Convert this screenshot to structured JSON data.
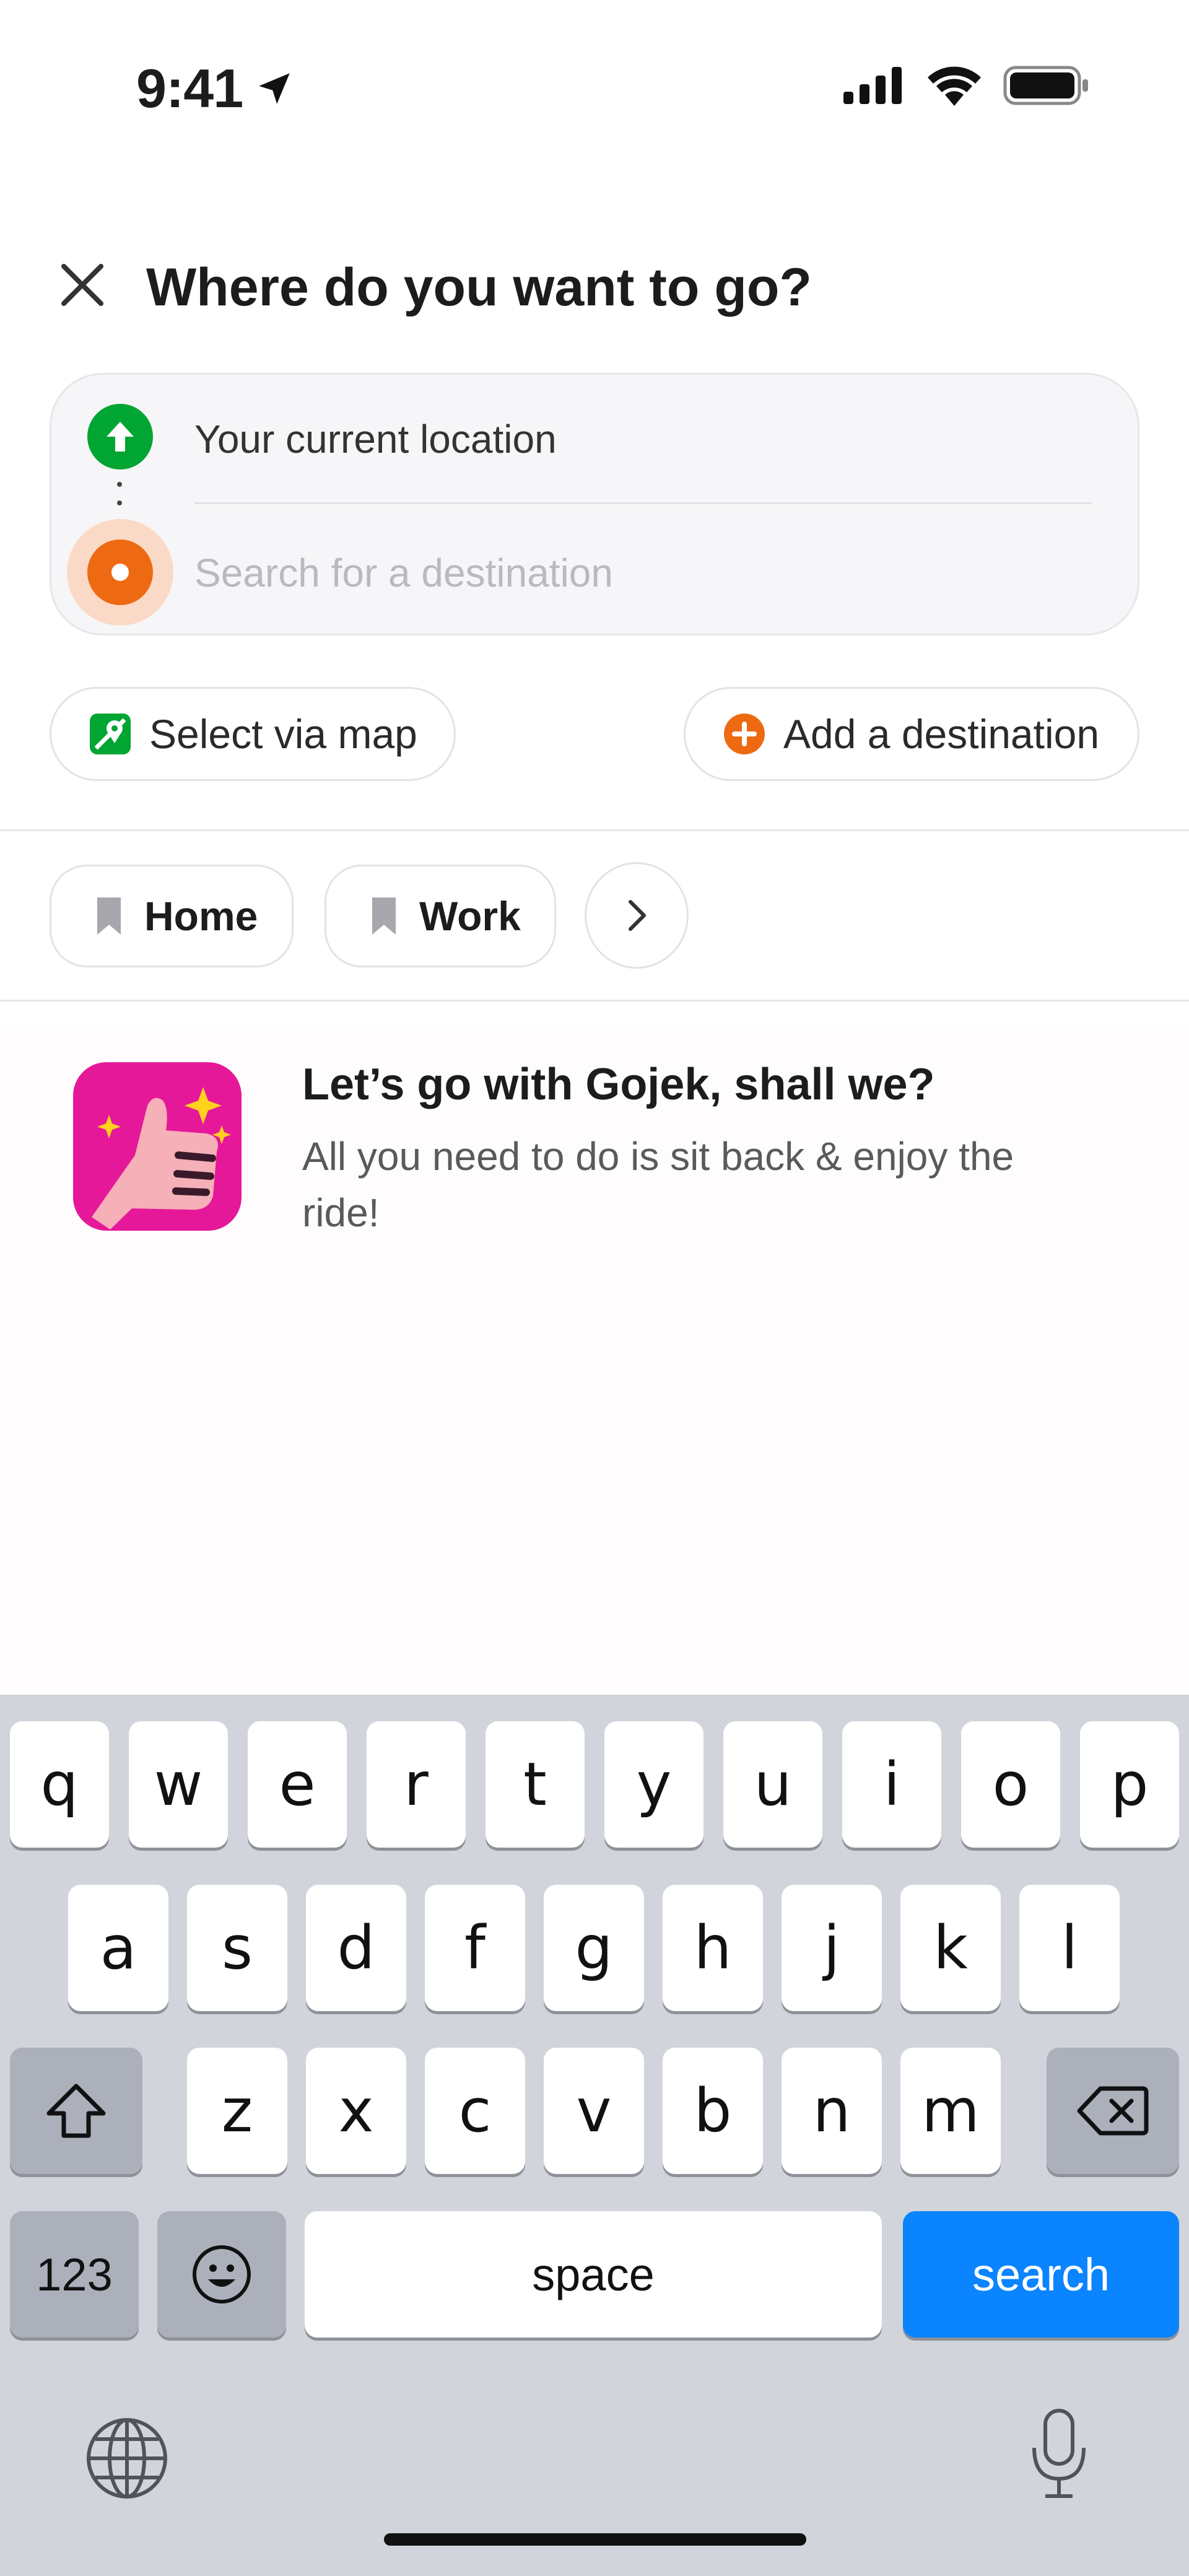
{
  "status_bar": {
    "time": "9:41"
  },
  "header": {
    "title": "Where do you want to go?"
  },
  "route": {
    "pickup_label": "Your current location",
    "destination_placeholder": "Search for a destination",
    "destination_value": ""
  },
  "actions": {
    "select_map": "Select via map",
    "add_destination": "Add a destination"
  },
  "saved_places": [
    {
      "label": "Home"
    },
    {
      "label": "Work"
    }
  ],
  "promo": {
    "title": "Let’s go with Gojek, shall we?",
    "subtitle": "All you need to do is sit back & enjoy the ride!"
  },
  "keyboard": {
    "row1": [
      "q",
      "w",
      "e",
      "r",
      "t",
      "y",
      "u",
      "i",
      "o",
      "p"
    ],
    "row2": [
      "a",
      "s",
      "d",
      "f",
      "g",
      "h",
      "j",
      "k",
      "l"
    ],
    "row3": [
      "z",
      "x",
      "c",
      "v",
      "b",
      "n",
      "m"
    ],
    "numbers_label": "123",
    "space_label": "space",
    "search_label": "search"
  },
  "colors": {
    "pickup": "#00a532",
    "destination": "#ee6a12",
    "promo_bg": "#e6189a",
    "search_key": "#0a84ff"
  },
  "icons": [
    "location-arrow-icon",
    "signal-icon",
    "wifi-icon",
    "battery-icon",
    "close-icon",
    "map-pin-icon",
    "add-icon",
    "bookmark-icon",
    "chevron-right-icon",
    "thumbs-up-icon",
    "shift-icon",
    "backspace-icon",
    "emoji-icon",
    "globe-icon",
    "microphone-icon"
  ]
}
